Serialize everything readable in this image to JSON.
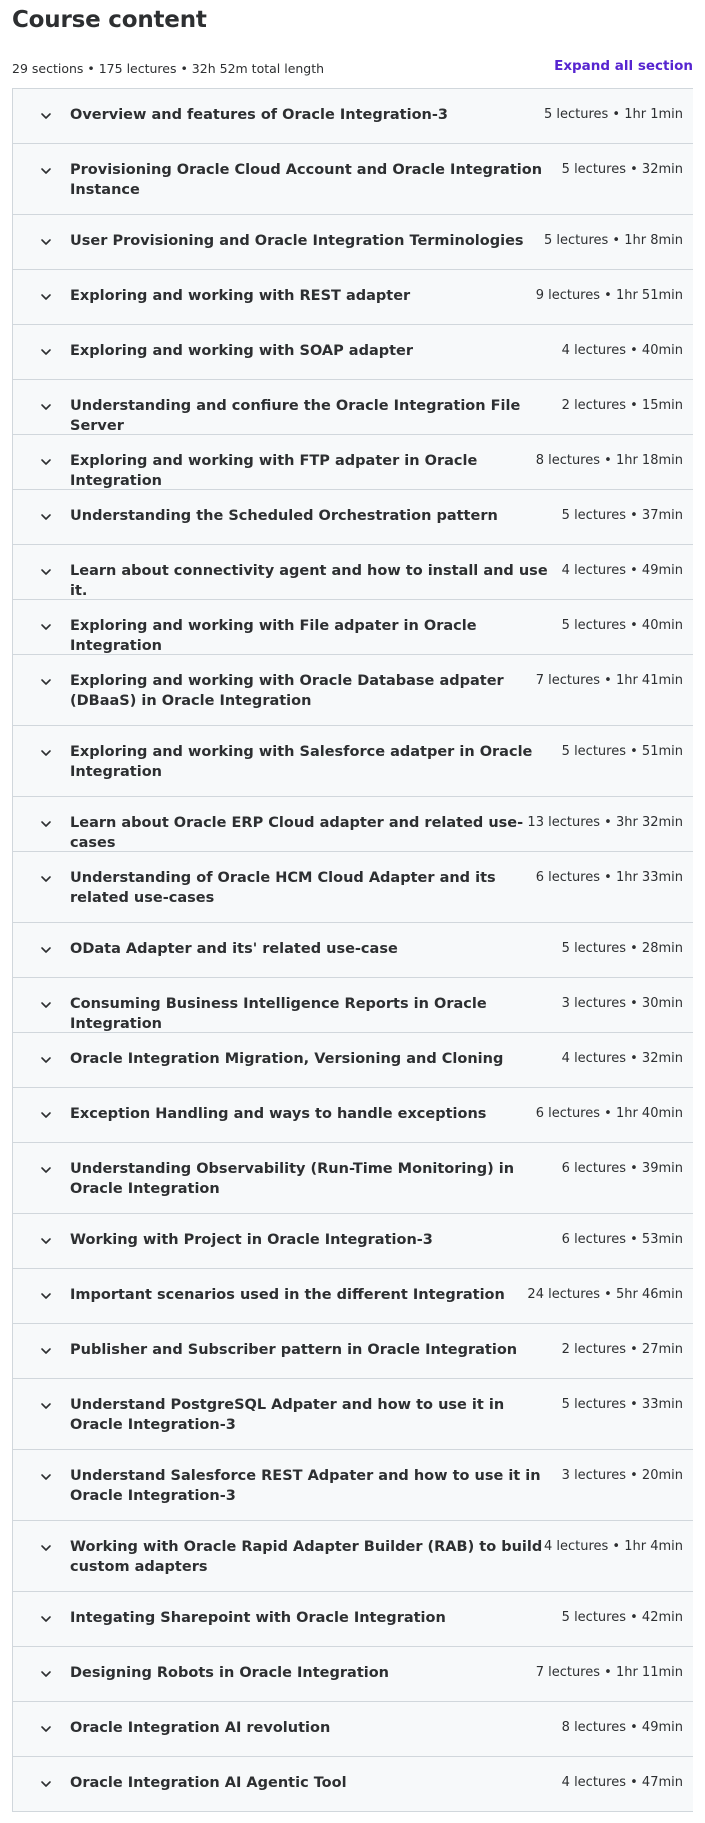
{
  "header": {
    "title": "Course content",
    "summary": "29 sections • 175 lectures • 32h 52m total length",
    "expand_label": "Expand all section"
  },
  "sections": [
    {
      "title": "Overview and features of Oracle Integration-3",
      "meta": "5 lectures • 1hr 1min"
    },
    {
      "title": "Provisioning Oracle Cloud Account and Oracle Integration Instance",
      "meta": "5 lectures • 32min"
    },
    {
      "title": "User Provisioning and Oracle Integration Terminologies",
      "meta": "5 lectures • 1hr 8min"
    },
    {
      "title": "Exploring and working with REST adapter",
      "meta": "9 lectures • 1hr 51min"
    },
    {
      "title": "Exploring and working with SOAP adapter",
      "meta": "4 lectures • 40min"
    },
    {
      "title": "Understanding and confiure the Oracle Integration File Server",
      "meta": "2 lectures • 15min"
    },
    {
      "title": "Exploring and working with FTP adpater in Oracle Integration",
      "meta": "8 lectures • 1hr 18min"
    },
    {
      "title": "Understanding the Scheduled Orchestration pattern",
      "meta": "5 lectures • 37min"
    },
    {
      "title": "Learn about connectivity agent and how to install and use it.",
      "meta": "4 lectures • 49min"
    },
    {
      "title": "Exploring and working with File adpater in Oracle Integration",
      "meta": "5 lectures • 40min"
    },
    {
      "title": "Exploring and working with Oracle Database adpater (DBaaS) in Oracle Integration",
      "meta": "7 lectures • 1hr 41min"
    },
    {
      "title": "Exploring and working with Salesforce adatper in Oracle Integration",
      "meta": "5 lectures • 51min"
    },
    {
      "title": "Learn about Oracle ERP Cloud adapter and related use-cases",
      "meta": "13 lectures • 3hr 32min"
    },
    {
      "title": "Understanding of Oracle HCM Cloud Adapter and its related use-cases",
      "meta": "6 lectures • 1hr 33min"
    },
    {
      "title": "OData Adapter and its' related use-case",
      "meta": "5 lectures • 28min"
    },
    {
      "title": "Consuming Business Intelligence Reports in Oracle Integration",
      "meta": "3 lectures • 30min"
    },
    {
      "title": "Oracle Integration Migration, Versioning and Cloning",
      "meta": "4 lectures • 32min"
    },
    {
      "title": "Exception Handling and ways to handle exceptions",
      "meta": "6 lectures • 1hr 40min"
    },
    {
      "title": "Understanding Observability (Run-Time Monitoring) in Oracle Integration",
      "meta": "6 lectures • 39min"
    },
    {
      "title": "Working with Project in Oracle Integration-3",
      "meta": "6 lectures • 53min"
    },
    {
      "title": "Important scenarios used in the different Integration",
      "meta": "24 lectures • 5hr 46min"
    },
    {
      "title": "Publisher and Subscriber pattern in Oracle Integration",
      "meta": "2 lectures • 27min"
    },
    {
      "title": "Understand PostgreSQL Adpater and how to use it in Oracle Integration-3",
      "meta": "5 lectures • 33min"
    },
    {
      "title": "Understand Salesforce REST Adpater and how to use it in Oracle Integration-3",
      "meta": "3 lectures • 20min"
    },
    {
      "title": "Working with Oracle Rapid Adapter Builder (RAB) to build custom adapters",
      "meta": "4 lectures • 1hr 4min"
    },
    {
      "title": "Integating Sharepoint with Oracle Integration",
      "meta": "5 lectures • 42min"
    },
    {
      "title": "Designing Robots in Oracle Integration",
      "meta": "7 lectures • 1hr 11min"
    },
    {
      "title": "Oracle Integration AI revolution",
      "meta": "8 lectures • 49min"
    },
    {
      "title": "Oracle Integration AI Agentic Tool",
      "meta": "4 lectures • 47min"
    }
  ],
  "icons": {
    "section_toggle": "chevron-down-icon"
  },
  "colors": {
    "accent": "#5624d0",
    "section_bg": "#f7f9fa",
    "border": "#d1d7dc",
    "text": "#2d2f31"
  }
}
